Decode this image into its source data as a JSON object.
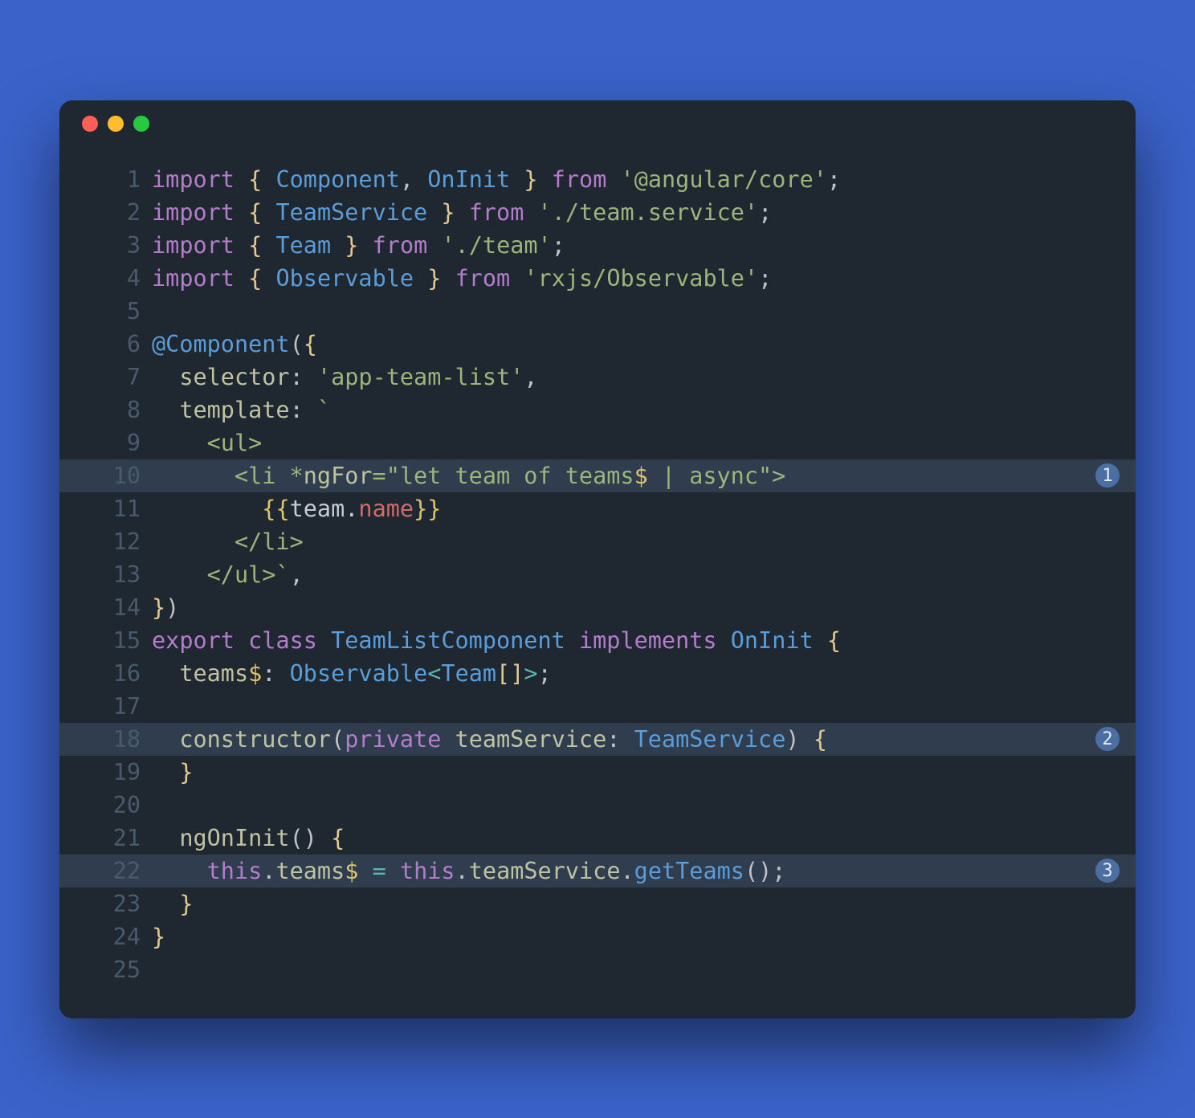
{
  "lines": [
    {
      "n": "1",
      "hl": false,
      "tokens": [
        {
          "t": "import",
          "c": "kw"
        },
        {
          "t": " ",
          "c": "pale"
        },
        {
          "t": "{",
          "c": "brace"
        },
        {
          "t": " ",
          "c": "pale"
        },
        {
          "t": "Component",
          "c": "type"
        },
        {
          "t": ",",
          "c": "pale"
        },
        {
          "t": " ",
          "c": "pale"
        },
        {
          "t": "OnInit",
          "c": "type"
        },
        {
          "t": " ",
          "c": "pale"
        },
        {
          "t": "}",
          "c": "brace"
        },
        {
          "t": " ",
          "c": "pale"
        },
        {
          "t": "from",
          "c": "kw"
        },
        {
          "t": " ",
          "c": "pale"
        },
        {
          "t": "'@angular/core'",
          "c": "str"
        },
        {
          "t": ";",
          "c": "pale"
        }
      ]
    },
    {
      "n": "2",
      "hl": false,
      "tokens": [
        {
          "t": "import",
          "c": "kw"
        },
        {
          "t": " ",
          "c": "pale"
        },
        {
          "t": "{",
          "c": "brace"
        },
        {
          "t": " ",
          "c": "pale"
        },
        {
          "t": "TeamService",
          "c": "type"
        },
        {
          "t": " ",
          "c": "pale"
        },
        {
          "t": "}",
          "c": "brace"
        },
        {
          "t": " ",
          "c": "pale"
        },
        {
          "t": "from",
          "c": "kw"
        },
        {
          "t": " ",
          "c": "pale"
        },
        {
          "t": "'./team.service'",
          "c": "str"
        },
        {
          "t": ";",
          "c": "pale"
        }
      ]
    },
    {
      "n": "3",
      "hl": false,
      "tokens": [
        {
          "t": "import",
          "c": "kw"
        },
        {
          "t": " ",
          "c": "pale"
        },
        {
          "t": "{",
          "c": "brace"
        },
        {
          "t": " ",
          "c": "pale"
        },
        {
          "t": "Team",
          "c": "type"
        },
        {
          "t": " ",
          "c": "pale"
        },
        {
          "t": "}",
          "c": "brace"
        },
        {
          "t": " ",
          "c": "pale"
        },
        {
          "t": "from",
          "c": "kw"
        },
        {
          "t": " ",
          "c": "pale"
        },
        {
          "t": "'./team'",
          "c": "str"
        },
        {
          "t": ";",
          "c": "pale"
        }
      ]
    },
    {
      "n": "4",
      "hl": false,
      "tokens": [
        {
          "t": "import",
          "c": "kw"
        },
        {
          "t": " ",
          "c": "pale"
        },
        {
          "t": "{",
          "c": "brace"
        },
        {
          "t": " ",
          "c": "pale"
        },
        {
          "t": "Observable",
          "c": "type"
        },
        {
          "t": " ",
          "c": "pale"
        },
        {
          "t": "}",
          "c": "brace"
        },
        {
          "t": " ",
          "c": "pale"
        },
        {
          "t": "from",
          "c": "kw"
        },
        {
          "t": " ",
          "c": "pale"
        },
        {
          "t": "'rxjs/Observable'",
          "c": "str"
        },
        {
          "t": ";",
          "c": "pale"
        }
      ]
    },
    {
      "n": "5",
      "hl": false,
      "tokens": []
    },
    {
      "n": "6",
      "hl": false,
      "tokens": [
        {
          "t": "@Component",
          "c": "type"
        },
        {
          "t": "(",
          "c": "pale"
        },
        {
          "t": "{",
          "c": "brace"
        }
      ]
    },
    {
      "n": "7",
      "hl": false,
      "tokens": [
        {
          "t": "  ",
          "c": "pale"
        },
        {
          "t": "selector",
          "c": "fn"
        },
        {
          "t": ":",
          "c": "pale"
        },
        {
          "t": " ",
          "c": "pale"
        },
        {
          "t": "'app-team-list'",
          "c": "str"
        },
        {
          "t": ",",
          "c": "pale"
        }
      ]
    },
    {
      "n": "8",
      "hl": false,
      "tokens": [
        {
          "t": "  ",
          "c": "pale"
        },
        {
          "t": "template",
          "c": "fn"
        },
        {
          "t": ":",
          "c": "pale"
        },
        {
          "t": " ",
          "c": "pale"
        },
        {
          "t": "`",
          "c": "str"
        }
      ]
    },
    {
      "n": "9",
      "hl": false,
      "tokens": [
        {
          "t": "    ",
          "c": "pale"
        },
        {
          "t": "<ul>",
          "c": "template-txt"
        }
      ]
    },
    {
      "n": "10",
      "hl": true,
      "badge": "1",
      "tokens": [
        {
          "t": "      ",
          "c": "pale"
        },
        {
          "t": "<li *",
          "c": "template-txt"
        },
        {
          "t": "ngFor",
          "c": "fn"
        },
        {
          "t": "=\"let team of teams",
          "c": "template-txt"
        },
        {
          "t": "$",
          "c": "gold"
        },
        {
          "t": " | async\">",
          "c": "template-txt"
        }
      ]
    },
    {
      "n": "11",
      "hl": false,
      "tokens": [
        {
          "t": "        ",
          "c": "pale"
        },
        {
          "t": "{{",
          "c": "gold"
        },
        {
          "t": "team",
          "c": "prop"
        },
        {
          "t": ".",
          "c": "prop"
        },
        {
          "t": "name",
          "c": "red"
        },
        {
          "t": "}}",
          "c": "gold"
        }
      ]
    },
    {
      "n": "12",
      "hl": false,
      "tokens": [
        {
          "t": "      ",
          "c": "pale"
        },
        {
          "t": "</li>",
          "c": "template-txt"
        }
      ]
    },
    {
      "n": "13",
      "hl": false,
      "tokens": [
        {
          "t": "    ",
          "c": "pale"
        },
        {
          "t": "</ul>",
          "c": "template-txt"
        },
        {
          "t": "`",
          "c": "str"
        },
        {
          "t": ",",
          "c": "pale"
        }
      ]
    },
    {
      "n": "14",
      "hl": false,
      "tokens": [
        {
          "t": "}",
          "c": "brace"
        },
        {
          "t": ")",
          "c": "pale"
        }
      ]
    },
    {
      "n": "15",
      "hl": false,
      "tokens": [
        {
          "t": "export",
          "c": "kw"
        },
        {
          "t": " ",
          "c": "pale"
        },
        {
          "t": "class",
          "c": "kw"
        },
        {
          "t": " ",
          "c": "pale"
        },
        {
          "t": "TeamListComponent",
          "c": "type"
        },
        {
          "t": " ",
          "c": "pale"
        },
        {
          "t": "implements",
          "c": "kw"
        },
        {
          "t": " ",
          "c": "pale"
        },
        {
          "t": "OnInit",
          "c": "type"
        },
        {
          "t": " ",
          "c": "pale"
        },
        {
          "t": "{",
          "c": "brace"
        }
      ]
    },
    {
      "n": "16",
      "hl": false,
      "tokens": [
        {
          "t": "  ",
          "c": "pale"
        },
        {
          "t": "teams",
          "c": "fn"
        },
        {
          "t": "$",
          "c": "gold"
        },
        {
          "t": ":",
          "c": "pale"
        },
        {
          "t": " ",
          "c": "pale"
        },
        {
          "t": "Observable",
          "c": "type"
        },
        {
          "t": "<",
          "c": "op"
        },
        {
          "t": "Team",
          "c": "type"
        },
        {
          "t": "[",
          "c": "brace"
        },
        {
          "t": "]",
          "c": "brace"
        },
        {
          "t": ">",
          "c": "op"
        },
        {
          "t": ";",
          "c": "pale"
        }
      ]
    },
    {
      "n": "17",
      "hl": false,
      "tokens": []
    },
    {
      "n": "18",
      "hl": true,
      "badge": "2",
      "tokens": [
        {
          "t": "  ",
          "c": "pale"
        },
        {
          "t": "constructor",
          "c": "fn"
        },
        {
          "t": "(",
          "c": "pale"
        },
        {
          "t": "private",
          "c": "kw"
        },
        {
          "t": " ",
          "c": "pale"
        },
        {
          "t": "teamService",
          "c": "fn"
        },
        {
          "t": ":",
          "c": "pale"
        },
        {
          "t": " ",
          "c": "pale"
        },
        {
          "t": "TeamService",
          "c": "type"
        },
        {
          "t": ")",
          "c": "pale"
        },
        {
          "t": " ",
          "c": "pale"
        },
        {
          "t": "{",
          "c": "brace"
        }
      ]
    },
    {
      "n": "19",
      "hl": false,
      "tokens": [
        {
          "t": "  ",
          "c": "pale"
        },
        {
          "t": "}",
          "c": "brace"
        }
      ]
    },
    {
      "n": "20",
      "hl": false,
      "tokens": []
    },
    {
      "n": "21",
      "hl": false,
      "tokens": [
        {
          "t": "  ",
          "c": "pale"
        },
        {
          "t": "ngOnInit",
          "c": "fn"
        },
        {
          "t": "(",
          "c": "pale"
        },
        {
          "t": ")",
          "c": "pale"
        },
        {
          "t": " ",
          "c": "pale"
        },
        {
          "t": "{",
          "c": "brace"
        }
      ]
    },
    {
      "n": "22",
      "hl": true,
      "badge": "3",
      "tokens": [
        {
          "t": "    ",
          "c": "pale"
        },
        {
          "t": "this",
          "c": "kw"
        },
        {
          "t": ".",
          "c": "pale"
        },
        {
          "t": "teams",
          "c": "fn"
        },
        {
          "t": "$",
          "c": "gold"
        },
        {
          "t": " ",
          "c": "pale"
        },
        {
          "t": "=",
          "c": "op"
        },
        {
          "t": " ",
          "c": "pale"
        },
        {
          "t": "this",
          "c": "kw"
        },
        {
          "t": ".",
          "c": "pale"
        },
        {
          "t": "teamService",
          "c": "fn"
        },
        {
          "t": ".",
          "c": "pale"
        },
        {
          "t": "getTeams",
          "c": "type"
        },
        {
          "t": "(",
          "c": "pale"
        },
        {
          "t": ")",
          "c": "pale"
        },
        {
          "t": ";",
          "c": "pale"
        }
      ]
    },
    {
      "n": "23",
      "hl": false,
      "tokens": [
        {
          "t": "  ",
          "c": "pale"
        },
        {
          "t": "}",
          "c": "brace"
        }
      ]
    },
    {
      "n": "24",
      "hl": false,
      "tokens": [
        {
          "t": "}",
          "c": "brace"
        }
      ]
    },
    {
      "n": "25",
      "hl": false,
      "tokens": []
    }
  ]
}
